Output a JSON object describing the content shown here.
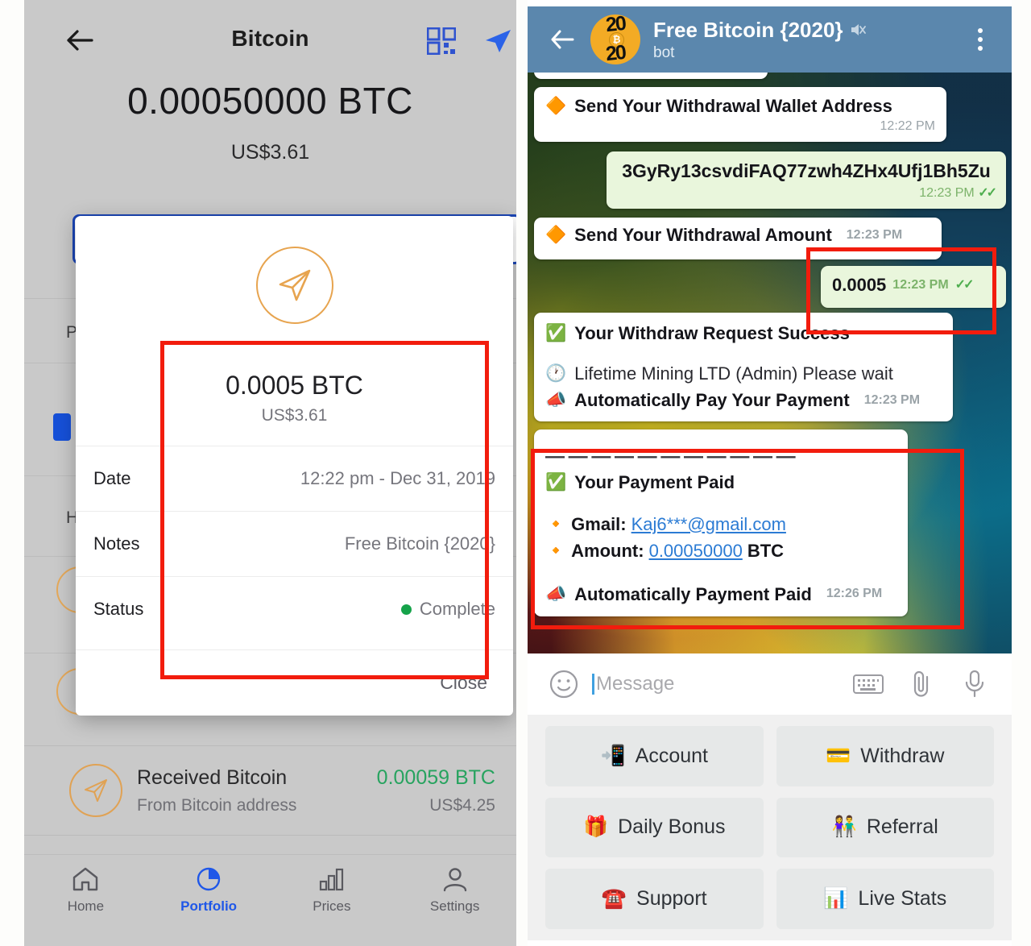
{
  "wallet": {
    "header": {
      "back_icon": "back-arrow-icon",
      "title": "Bitcoin",
      "qr_icon": "qr-code-icon",
      "send_icon": "send-plane-icon"
    },
    "balance_btc": "0.00050000 BTC",
    "balance_fiat": "US$3.61",
    "dialog": {
      "icon": "send-plane-circle-icon",
      "amount": "0.0005 BTC",
      "fiat": "US$3.61",
      "rows": [
        {
          "label": "Date",
          "value": "12:22 pm - Dec 31, 2019"
        },
        {
          "label": "Notes",
          "value": "Free Bitcoin {2020}"
        },
        {
          "label": "Status",
          "value": "Complete",
          "dot_color": "#16a34a"
        }
      ],
      "close_label": "Close"
    },
    "background_labels": {
      "row1": "P",
      "row2": "H"
    },
    "received": {
      "icon": "send-plane-circle-icon",
      "title": "Received Bitcoin",
      "subtitle": "From Bitcoin address",
      "amount": "0.00059 BTC",
      "fiat": "US$4.25",
      "amount_color": "#27a35f"
    },
    "nav": [
      {
        "icon": "home-icon",
        "label": "Home",
        "active": false
      },
      {
        "icon": "pie-chart-icon",
        "label": "Portfolio",
        "active": true
      },
      {
        "icon": "bar-chart-icon",
        "label": "Prices",
        "active": false
      },
      {
        "icon": "person-icon",
        "label": "Settings",
        "active": false
      }
    ]
  },
  "telegram": {
    "header": {
      "back_icon": "back-arrow-icon",
      "avatar_top": "20",
      "avatar_bottom": "20",
      "avatar_symbol": "₿",
      "title": "Free Bitcoin {2020}",
      "mute_icon": "muted-speaker-icon",
      "subtitle": "bot",
      "menu_icon": "overflow-menu-icon"
    },
    "messages": [
      {
        "side": "in",
        "emoji": "🔶",
        "emoji_name": "red-diamond-icon",
        "text": "Send Your Withdrawal Wallet Address",
        "time": "12:22 PM",
        "ticks": false
      },
      {
        "side": "out",
        "text": "3GyRy13csvdiFAQ77zwh4ZHx4Ufj1Bh5Zu",
        "time": "12:23 PM",
        "ticks": true
      },
      {
        "side": "in",
        "emoji": "🔶",
        "emoji_name": "red-diamond-icon",
        "text": "Send Your Withdrawal Amount",
        "time": "12:23 PM",
        "ticks": false
      },
      {
        "side": "out",
        "text": "0.0005",
        "time": "12:23 PM",
        "ticks": true
      },
      {
        "side": "in",
        "emoji": "✅",
        "emoji_name": "check-mark-button-icon",
        "text": "Your Withdraw Request Success",
        "line2_emoji": "🕐",
        "line2_emoji_name": "clock-icon",
        "line2": "Lifetime Mining LTD (Admin) Please wait",
        "line3_emoji": "📣",
        "line3_emoji_name": "megaphone-icon",
        "line3": "Automatically Pay Your Payment",
        "time": "12:23 PM",
        "ticks": false
      },
      {
        "side": "in",
        "divider": "— — — — — — — — — — —",
        "emoji": "✅",
        "emoji_name": "check-mark-button-icon",
        "text": "Your Payment Paid",
        "gmail_emoji": "🔸",
        "gmail_emoji_name": "orange-diamond-icon",
        "gmail_label": "Gmail:",
        "gmail_value": "Kaj6***@gmail.com",
        "amount_emoji": "🔸",
        "amount_emoji_name": "orange-diamond-icon",
        "amount_label": "Amount:",
        "amount_value": "0.00050000",
        "amount_unit": "BTC",
        "footer_emoji": "📣",
        "footer_emoji_name": "megaphone-icon",
        "footer": "Automatically Payment Paid",
        "time": "12:26 PM",
        "ticks": false
      }
    ],
    "compose": {
      "emoji_icon": "smiley-face-icon",
      "placeholder": "Message",
      "keyboard_icon": "keyboard-icon",
      "attach_icon": "paperclip-icon",
      "mic_icon": "microphone-icon"
    },
    "keypad": [
      {
        "emoji": "📲",
        "emoji_name": "mobile-phone-arrow-icon",
        "label": "Account"
      },
      {
        "emoji": "💳",
        "emoji_name": "credit-card-icon",
        "label": "Withdraw"
      },
      {
        "emoji": "🎁",
        "emoji_name": "gift-icon",
        "label": "Daily Bonus"
      },
      {
        "emoji": "👫",
        "emoji_name": "couple-icon",
        "label": "Referral"
      },
      {
        "emoji": "☎️",
        "emoji_name": "telephone-icon",
        "label": "Support"
      },
      {
        "emoji": "📊",
        "emoji_name": "bar-chart-icon",
        "label": "Live Stats"
      }
    ]
  },
  "annotations": {
    "highlight_color": "#f21c0d",
    "boxes": [
      "transaction-detail-highlight",
      "withdrawal-amount-highlight",
      "payment-paid-highlight"
    ]
  }
}
